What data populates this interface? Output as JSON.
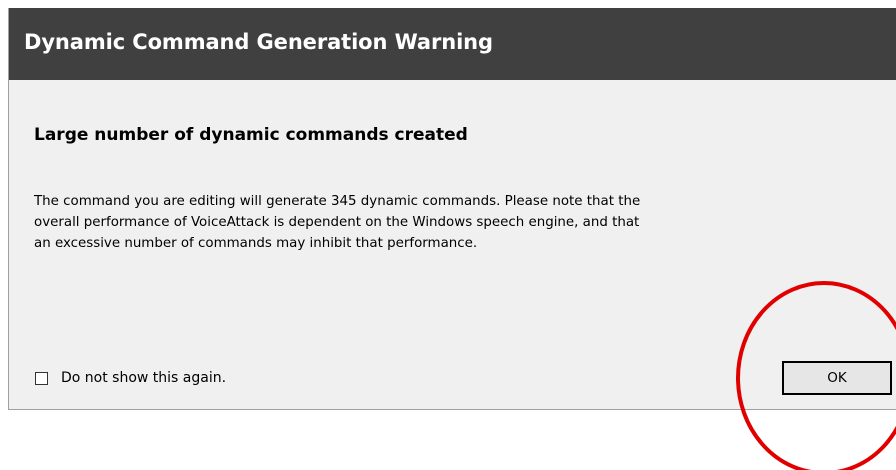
{
  "window": {
    "title": "Dynamic Command Generation Warning"
  },
  "content": {
    "heading": "Large number of dynamic commands created",
    "message_lines": [
      "The command you are editing will generate 345 dynamic commands.  Please note that the",
      "overall performance of VoiceAttack is dependent on the Windows speech engine, and that",
      "an excessive number of commands may inhibit that performance."
    ]
  },
  "footer": {
    "checkbox_label": "Do not show this again.",
    "checkbox_checked": false,
    "ok_label": "OK"
  },
  "colors": {
    "titlebar": "#404040",
    "dialog_bg": "#f0f0f0",
    "annotation_circle": "#e00000"
  }
}
